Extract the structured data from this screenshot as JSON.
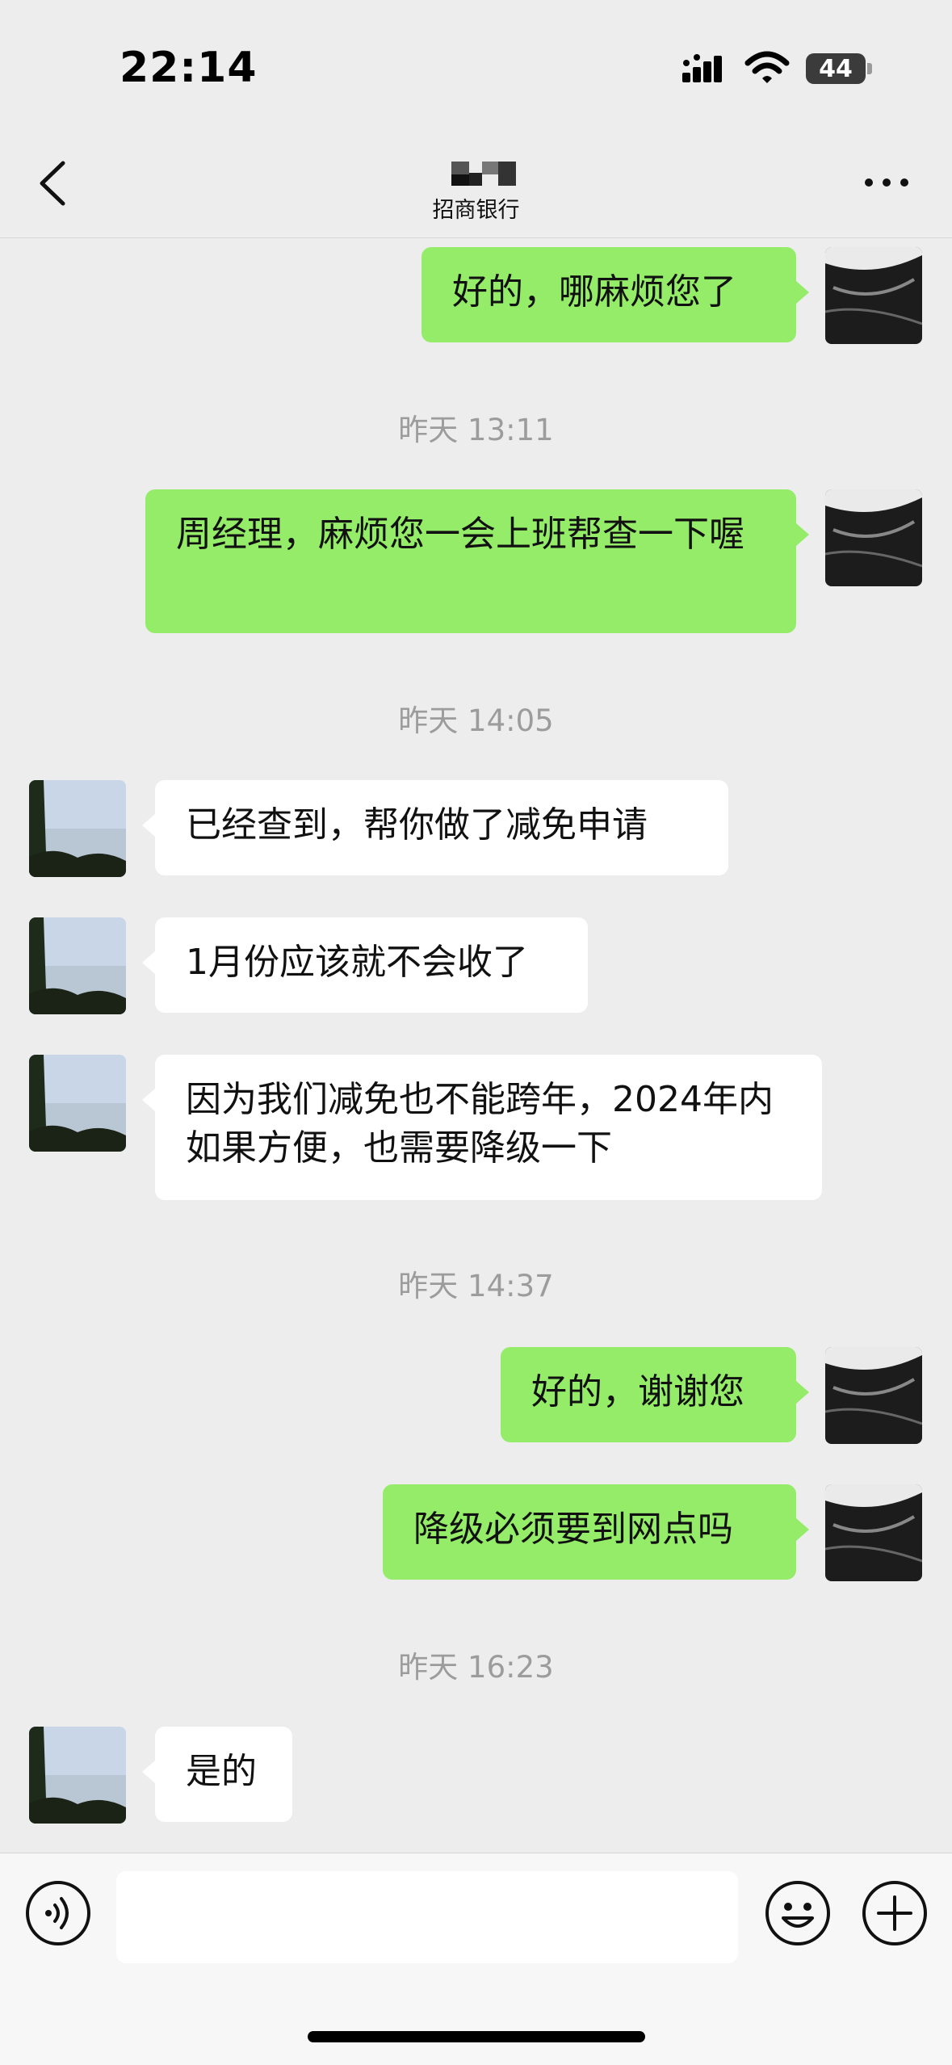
{
  "status_bar": {
    "time": "22:14",
    "battery": "44"
  },
  "nav": {
    "title": "招商银行",
    "back_icon": "chevron-left-icon",
    "more_icon": "more-dots-icon"
  },
  "messages": [
    {
      "side": "me",
      "text": "好的，哪麻烦您了"
    },
    {
      "type": "time",
      "text": "昨天 13:11"
    },
    {
      "side": "me",
      "text": "周经理，麻烦您一会上班帮查一下喔"
    },
    {
      "type": "time",
      "text": "昨天 14:05"
    },
    {
      "side": "them",
      "text": "已经查到，帮你做了减免申请"
    },
    {
      "side": "them",
      "text": "1月份应该就不会收了"
    },
    {
      "side": "them",
      "text": "因为我们减免也不能跨年，2024年内如果方便，也需要降级一下"
    },
    {
      "type": "time",
      "text": "昨天 14:37"
    },
    {
      "side": "me",
      "text": "好的，谢谢您"
    },
    {
      "side": "me",
      "text": "降级必须要到网点吗"
    },
    {
      "type": "time",
      "text": "昨天 16:23"
    },
    {
      "side": "them",
      "text": "是的"
    }
  ],
  "input_bar": {
    "text_value": "",
    "voice_icon": "voice-icon",
    "emoji_icon": "emoji-icon",
    "plus_icon": "plus-icon"
  },
  "colors": {
    "my_bubble": "#95ec69",
    "their_bubble": "#ffffff",
    "background": "#ededed"
  }
}
